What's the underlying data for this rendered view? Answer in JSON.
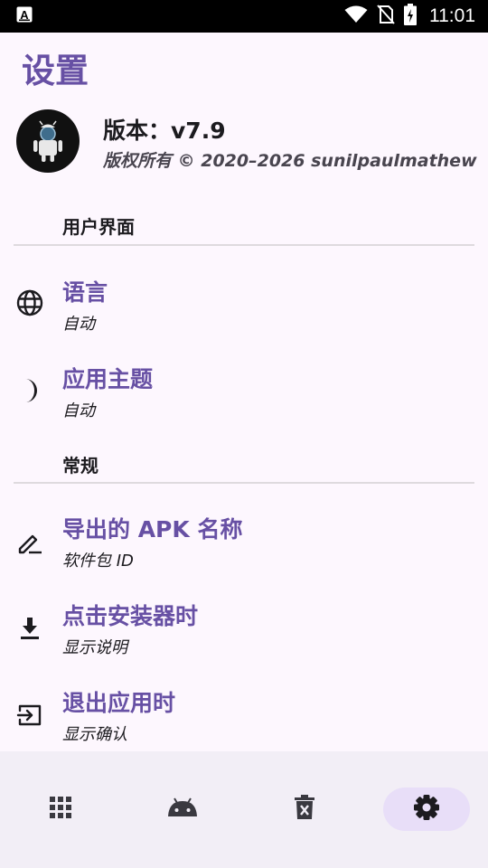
{
  "status_bar": {
    "time": "11:01"
  },
  "page": {
    "title": "设置"
  },
  "app_info": {
    "version": "版本：v7.9",
    "copyright": "版权所有 © 2020–2026 sunilpaulmathew"
  },
  "sections": {
    "ui": "用户界面",
    "general": "常规"
  },
  "preferences": {
    "language": {
      "title": "语言",
      "summary": "自动",
      "icon": "globe-icon"
    },
    "theme": {
      "title": "应用主题",
      "summary": "自动",
      "icon": "moon-icon"
    },
    "apk_name": {
      "title": "导出的 APK 名称",
      "summary": "软件包 ID",
      "icon": "edit-icon"
    },
    "installer": {
      "title": "点击安装器时",
      "summary": "显示说明",
      "icon": "download-icon"
    },
    "exit": {
      "title": "退出应用时",
      "summary": "显示确认",
      "icon": "exit-icon"
    }
  },
  "bottom_nav": {
    "items": [
      "apps-grid-icon",
      "android-icon",
      "uninstall-icon",
      "settings-icon"
    ],
    "active": "settings-icon"
  },
  "colors": {
    "accent": "#6750a4",
    "background": "#fdf7fe",
    "nav_background": "#f2eef6",
    "nav_active": "#e8def8"
  }
}
